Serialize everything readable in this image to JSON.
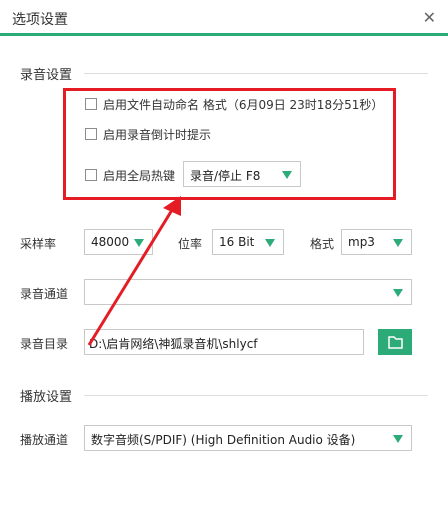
{
  "window": {
    "title": "选项设置",
    "close_glyph": "✕"
  },
  "recording_section": {
    "heading": "录音设置",
    "auto_name": {
      "checked": false,
      "label": "启用文件自动命名 格式（6月09日 23时18分51秒）"
    },
    "countdown": {
      "checked": false,
      "label": "启用录音倒计时提示"
    },
    "hotkey": {
      "checked": false,
      "label": "启用全局热键",
      "value": "录音/停止 F8"
    },
    "sample_rate": {
      "label": "采样率",
      "value": "48000"
    },
    "bit_depth": {
      "label": "位率",
      "value": "16 Bit"
    },
    "format": {
      "label": "格式",
      "value": "mp3"
    },
    "channel": {
      "label": "录音通道",
      "value": ""
    },
    "directory": {
      "label": "录音目录",
      "value": "D:\\启肯网络\\神狐录音机\\shlycf"
    }
  },
  "playback_section": {
    "heading": "播放设置",
    "channel": {
      "label": "播放通道",
      "value": "数字音频(S/PDIF) (High Definition Audio 设备)"
    }
  },
  "annotation": {
    "color": "#e51c24"
  },
  "accent_color": "#2cab78",
  "icons": [
    "close-icon",
    "folder-icon",
    "dropdown-arrow-icon"
  ]
}
